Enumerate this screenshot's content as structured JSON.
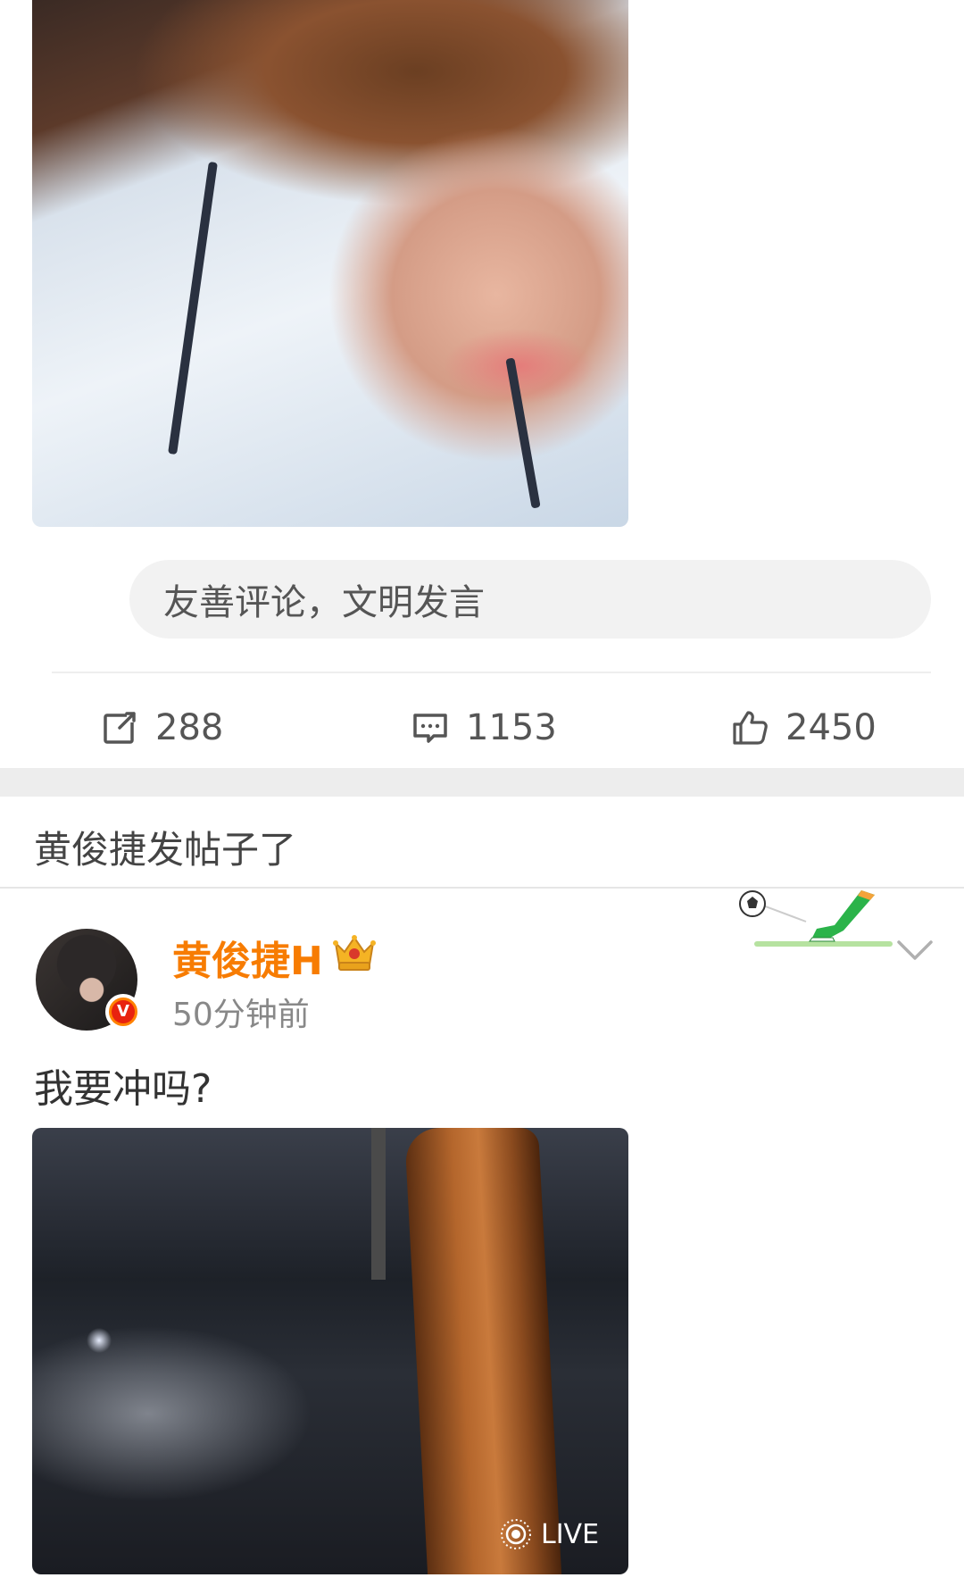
{
  "comment": {
    "placeholder": "友善评论，文明发言"
  },
  "actions": {
    "reposts": "288",
    "comments": "1153",
    "likes": "2450"
  },
  "topic": "黄俊捷发帖子了",
  "post": {
    "username": "黄俊捷H",
    "timestamp": "50分钟前",
    "text": "我要冲吗?",
    "badge": "V",
    "live_label": "LIVE"
  },
  "colors": {
    "accent": "#f77c02",
    "verified": "#ff8200",
    "gap": "#ededed"
  },
  "icons": [
    "repost-icon",
    "comment-icon",
    "like-icon",
    "crown-icon",
    "verified-icon",
    "soccer-decoration",
    "chevron-down-icon",
    "live-photo-icon"
  ]
}
